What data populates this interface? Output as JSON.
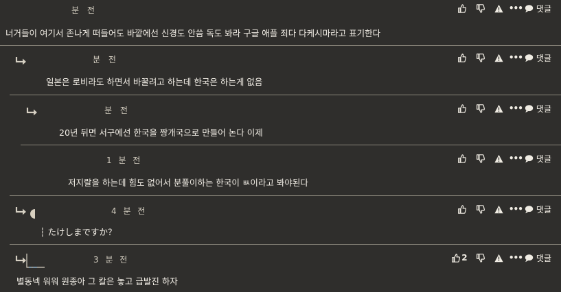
{
  "actions": {
    "like_icon": "thumbs-up-icon",
    "dislike_icon": "thumbs-down-icon",
    "report_icon": "warning-icon",
    "more_label": "•••",
    "reply_label": "댓글"
  },
  "comments": [
    {
      "time": "분 전",
      "text": "너거들이 여기서 존나게 떠들어도 바깥에선 신경도 안씀 독도 봐라 구글 애플 죄다 다케시마라고 표기한다",
      "likes": ""
    },
    {
      "time": "분 전",
      "text": "일본은 로비라도 하면서 바꿀려고 하는데 한국은 하는게 없음",
      "likes": ""
    },
    {
      "time": "분 전",
      "text": "20년 뒤면 서구에선 한국을 짱개국으로 만들어 논다 이제",
      "likes": ""
    },
    {
      "time": "1 분 전",
      "text": "저지랄을 하는데 힘도 없어서 분풀이하는 한국이 ㅄ이라고 봐야된다",
      "likes": ""
    },
    {
      "time": "4 분 전",
      "text": "┆ たけしまですか？",
      "likes": ""
    },
    {
      "time": "3 분 전",
      "text": "별동넥 워워 원종아 그 칼은 놓고 급발진 하자",
      "likes": "2"
    }
  ]
}
